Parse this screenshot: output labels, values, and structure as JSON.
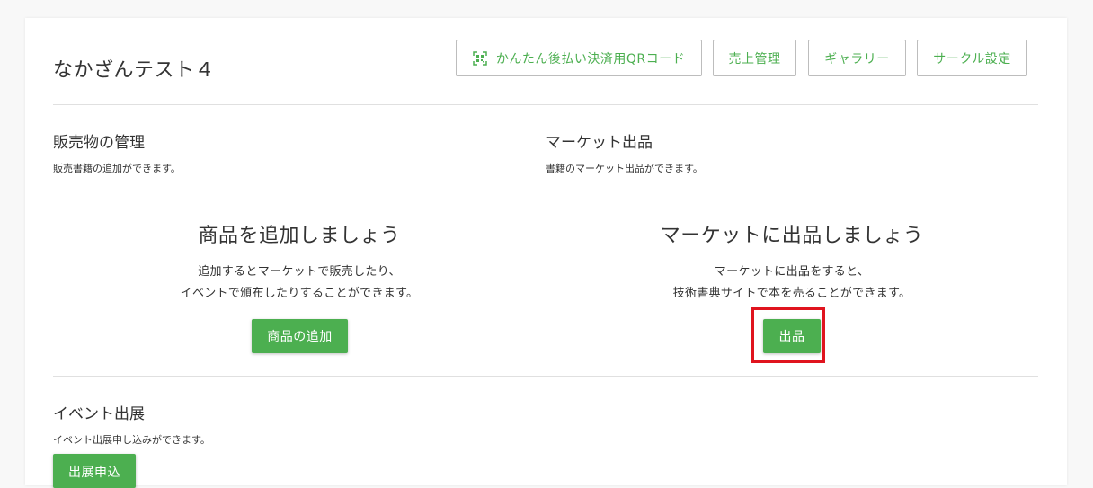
{
  "circle": {
    "name": "なかざんテスト４"
  },
  "toolbar": {
    "qr_label": "かんたん後払い決済用QRコード",
    "sales_label": "売上管理",
    "gallery_label": "ギャラリー",
    "settings_label": "サークル設定"
  },
  "products": {
    "title": "販売物の管理",
    "desc": "販売書籍の追加ができます。",
    "cta_title": "商品を追加しましょう",
    "cta_line1": "追加するとマーケットで販売したり、",
    "cta_line2": "イベントで頒布したりすることができます。",
    "button": "商品の追加"
  },
  "market": {
    "title": "マーケット出品",
    "desc": "書籍のマーケット出品ができます。",
    "cta_title": "マーケットに出品しましょう",
    "cta_line1": "マーケットに出品をすると、",
    "cta_line2": "技術書典サイトで本を売ることができます。",
    "button": "出品"
  },
  "event": {
    "title": "イベント出展",
    "desc": "イベント出展申し込みができます。",
    "button": "出展申込"
  },
  "colors": {
    "accent": "#4caf50",
    "highlight": "#e0141e"
  },
  "icons": {
    "qr": "qr-code-icon"
  }
}
